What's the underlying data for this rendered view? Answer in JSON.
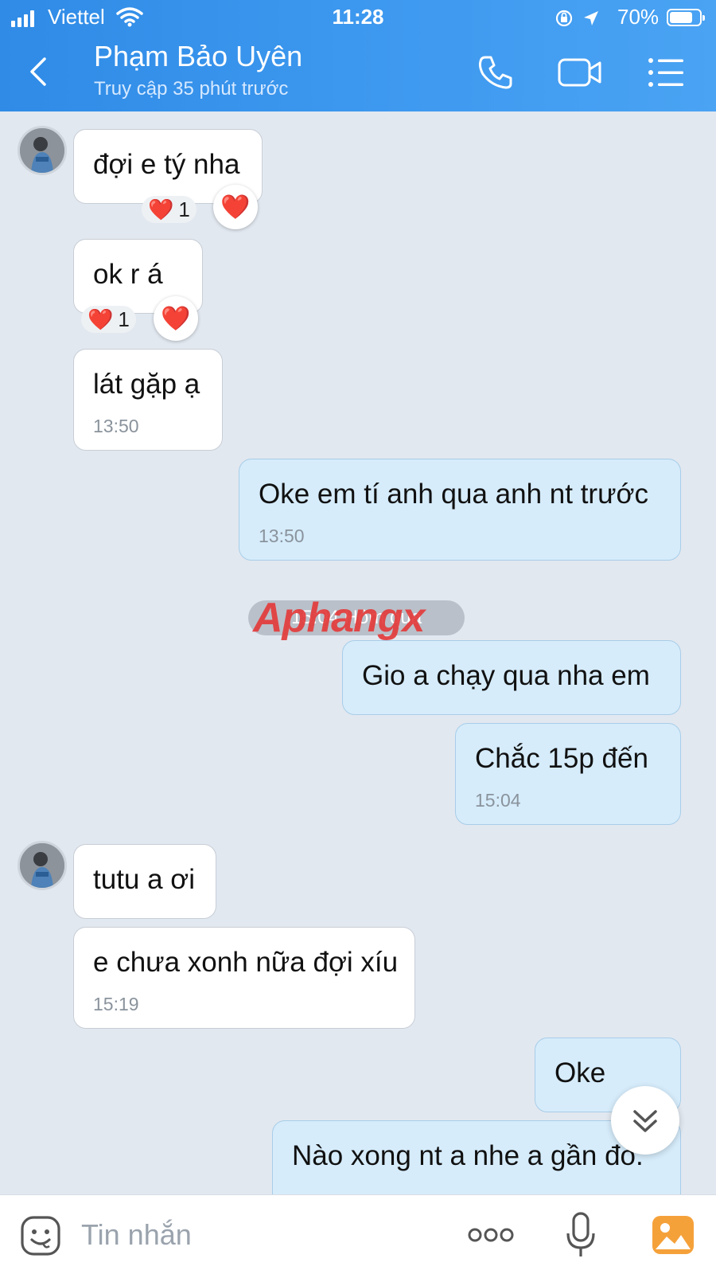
{
  "status_bar": {
    "carrier": "Viettel",
    "time": "11:28",
    "battery": "70%",
    "battery_level": 0.7
  },
  "header": {
    "contact_name": "Phạm Bảo Uyên",
    "last_seen": "Truy cập 35 phút trước",
    "icons": [
      "back-chevron-icon",
      "phone-icon",
      "video-camera-icon",
      "menu-list-icon"
    ]
  },
  "messages": [
    {
      "direction": "in",
      "text": "đợi e tý nha",
      "reaction": "❤️",
      "reaction_count": "1"
    },
    {
      "direction": "in",
      "text": "ok r á",
      "reaction": "❤️",
      "reaction_count": "1"
    },
    {
      "direction": "in",
      "text": "lát gặp ạ",
      "time": "13:50"
    },
    {
      "direction": "out",
      "text": "Oke em tí anh qua anh nt trước",
      "time": "13:50"
    },
    {
      "direction": "out",
      "text": "Gio a chạy qua nha em"
    },
    {
      "direction": "out",
      "text": "Chắc 15p đến",
      "time": "15:04"
    },
    {
      "direction": "in",
      "text": "tutu a ơi"
    },
    {
      "direction": "in",
      "text": "e chưa xonh nữa đợi xíu",
      "time": "15:19"
    },
    {
      "direction": "out",
      "text": "Oke"
    },
    {
      "direction": "out",
      "text": "Nào xong nt a nhe a gần đó."
    }
  ],
  "date_divider": "15:04 Hôm qua",
  "watermark": "Aphangx",
  "heart_glyph": "❤️",
  "input": {
    "placeholder": "Tin nhắn"
  },
  "colors": {
    "header": "#3f9af0",
    "chat_bg": "#e2e8f0",
    "outgoing_bubble": "#d6ecfb",
    "incoming_bubble": "#ffffff",
    "attach_accent": "#f5a13a"
  }
}
